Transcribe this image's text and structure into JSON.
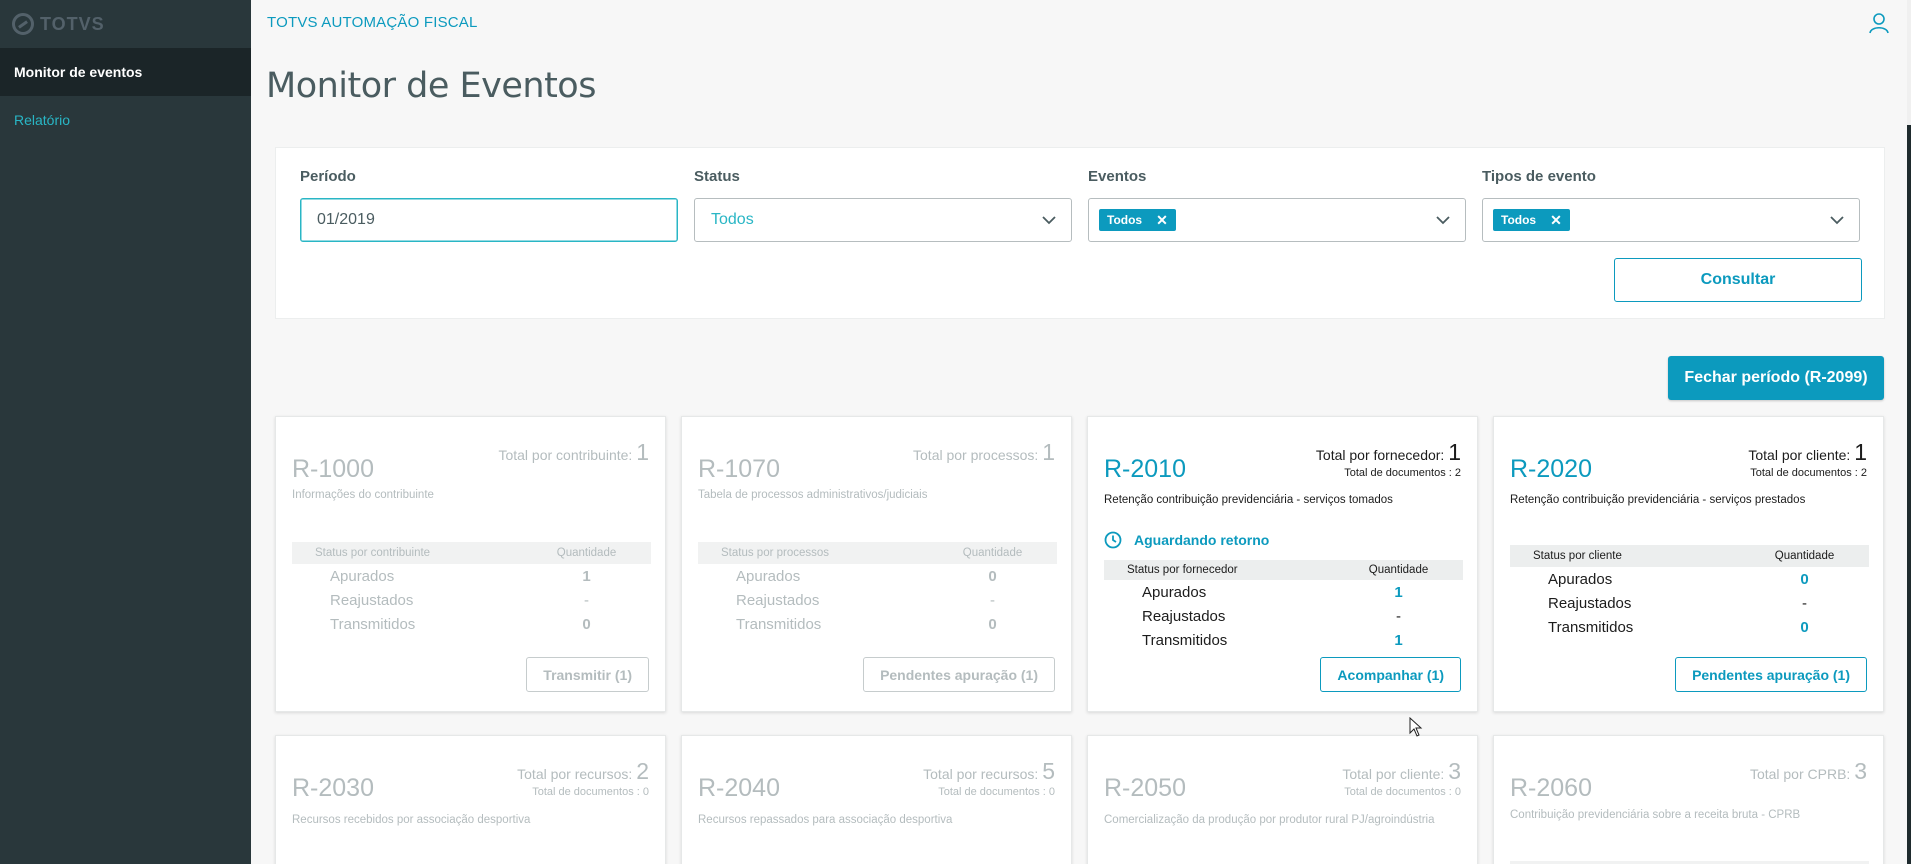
{
  "brand": "TOTVS",
  "app_title": "TOTVS AUTOMAÇÃO FISCAL",
  "sidebar": {
    "items": [
      {
        "label": "Monitor de eventos",
        "active": true
      },
      {
        "label": "Relatório",
        "active": false
      }
    ]
  },
  "page_title": "Monitor de Eventos",
  "filters": {
    "periodo": {
      "label": "Período",
      "value": "01/2019"
    },
    "status": {
      "label": "Status",
      "value": "Todos"
    },
    "eventos": {
      "label": "Eventos",
      "tag": "Todos"
    },
    "tipos": {
      "label": "Tipos de evento",
      "tag": "Todos"
    },
    "consultar": "Consultar"
  },
  "fechar_periodo": "Fechar período (R-2099)",
  "cards": [
    {
      "code": "R-1000",
      "total_label": "Total por contribuinte:",
      "total_value": "1",
      "description": "Informações do contribuinte",
      "col_status": "Status por contribuinte",
      "col_qty": "Quantidade",
      "rows": [
        {
          "label": "Apurados",
          "value": "1"
        },
        {
          "label": "Reajustados",
          "value": "-"
        },
        {
          "label": "Transmitidos",
          "value": "0"
        }
      ],
      "action": "Transmitir (1)"
    },
    {
      "code": "R-1070",
      "total_label": "Total por processos:",
      "total_value": "1",
      "description": "Tabela de processos administrativos/judiciais",
      "col_status": "Status por processos",
      "col_qty": "Quantidade",
      "rows": [
        {
          "label": "Apurados",
          "value": "0"
        },
        {
          "label": "Reajustados",
          "value": "-"
        },
        {
          "label": "Transmitidos",
          "value": "0"
        }
      ],
      "action": "Pendentes apuração (1)"
    },
    {
      "code": "R-2010",
      "total_label": "Total por fornecedor:",
      "total_value": "1",
      "docs": "Total de documentos : 2",
      "description": "Retenção contribuição previdenciária - serviços tomados",
      "status": "Aguardando retorno",
      "col_status": "Status por fornecedor",
      "col_qty": "Quantidade",
      "rows": [
        {
          "label": "Apurados",
          "value": "1"
        },
        {
          "label": "Reajustados",
          "value": "-"
        },
        {
          "label": "Transmitidos",
          "value": "1"
        }
      ],
      "action": "Acompanhar (1)"
    },
    {
      "code": "R-2020",
      "total_label": "Total por cliente:",
      "total_value": "1",
      "docs": "Total de documentos : 2",
      "description": "Retenção contribuição previdenciária - serviços prestados",
      "col_status": "Status por cliente",
      "col_qty": "Quantidade",
      "rows": [
        {
          "label": "Apurados",
          "value": "0"
        },
        {
          "label": "Reajustados",
          "value": "-"
        },
        {
          "label": "Transmitidos",
          "value": "0"
        }
      ],
      "action": "Pendentes apuração (1)"
    },
    {
      "code": "R-2030",
      "total_label": "Total por recursos:",
      "total_value": "2",
      "docs": "Total de documentos : 0",
      "description": "Recursos recebidos por associação desportiva"
    },
    {
      "code": "R-2040",
      "total_label": "Total por recursos:",
      "total_value": "5",
      "docs": "Total de documentos : 0",
      "description": "Recursos repassados para associação desportiva"
    },
    {
      "code": "R-2050",
      "total_label": "Total por cliente:",
      "total_value": "3",
      "docs": "Total de documentos : 0",
      "description": "Comercialização da produção por produtor rural PJ/agroindústria"
    },
    {
      "code": "R-2060",
      "total_label": "Total por CPRB:",
      "total_value": "3",
      "description": "Contribuição previdenciária sobre a receita bruta - CPRB"
    }
  ],
  "colors": {
    "sidebar_bg": "#29373b",
    "accent": "#0c9abe",
    "link": "#29b6c5"
  }
}
